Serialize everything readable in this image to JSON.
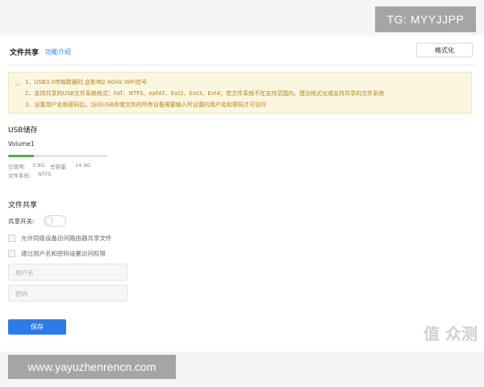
{
  "header": {
    "title": "文件共享",
    "feature_link": "功能介绍",
    "format_button": "格式化"
  },
  "notice": {
    "icon": "info-icon",
    "lines": [
      "1、USB3.0传输数据时,会影响2.4GHz WiFi信号",
      "2、支持共享的USB文件系统格式：FAT、NTFS、exFAT、Ext2、Ext3、Ext4；若文件系统不在支持范围内，建议格式化或支持共享的文件系统",
      "3、设置用户名和密码后，访问USB存储文件的所有设备需要输入所设置的用户名和密码才可访问"
    ],
    "color": "#b5841c"
  },
  "usb_storage": {
    "section_title": "USB储存",
    "volume_name": "Volume1",
    "used_label": "已使用:",
    "used_value": "3.8G",
    "total_label": "总容量:",
    "total_value": "14.9G",
    "fs_label": "文件系统:",
    "fs_value": "NTFS",
    "used_fraction": 0.26,
    "bar_color": "#4caf50"
  },
  "file_share": {
    "section_title": "文件共享",
    "switch_label": "共享开关:",
    "switch_on": false,
    "option_lan_access": "允许同级设备访问路由器共享文件",
    "option_auth": "通过用户名和密码设置访问权限",
    "username_placeholder": "用户名",
    "password_placeholder": "密码",
    "save_button": "保存"
  },
  "overlays": {
    "tg_text": "TG: MYYJJPP",
    "url_text": "www.yayuzhenrencn.com",
    "watermark_text": "值 众测"
  },
  "colors": {
    "accent": "#2d7be5"
  }
}
